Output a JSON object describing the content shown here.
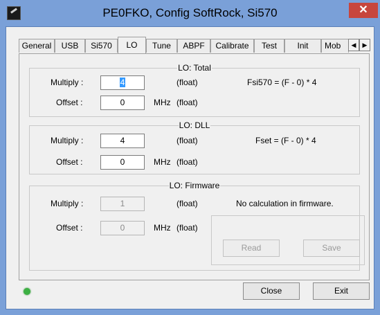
{
  "window": {
    "title": "PE0FKO, Config SoftRock, Si570",
    "close_glyph": "✕"
  },
  "tabs": [
    {
      "label": "General"
    },
    {
      "label": "USB"
    },
    {
      "label": "Si570"
    },
    {
      "label": "LO"
    },
    {
      "label": "Tune"
    },
    {
      "label": "ABPF"
    },
    {
      "label": "Calibrate"
    },
    {
      "label": "Test"
    },
    {
      "label": "Init"
    },
    {
      "label": "Mob"
    }
  ],
  "active_tab": "LO",
  "tab_scroll": {
    "left": "◀",
    "right": "▶"
  },
  "lo_total": {
    "title": "LO: Total",
    "multiply_label": "Multiply :",
    "multiply_value": "4",
    "multiply_unit": "(float)",
    "offset_label": "Offset :",
    "offset_value": "0",
    "offset_unit_mhz": "MHz",
    "offset_unit": "(float)",
    "formula": "Fsi570 = (F - 0) * 4"
  },
  "lo_dll": {
    "title": "LO: DLL",
    "multiply_label": "Multiply :",
    "multiply_value": "4",
    "multiply_unit": "(float)",
    "offset_label": "Offset :",
    "offset_value": "0",
    "offset_unit_mhz": "MHz",
    "offset_unit": "(float)",
    "formula": "Fset = (F - 0) * 4"
  },
  "lo_firmware": {
    "title": "LO: Firmware",
    "multiply_label": "Multiply :",
    "multiply_value": "1",
    "multiply_unit": "(float)",
    "offset_label": "Offset :",
    "offset_value": "0",
    "offset_unit_mhz": "MHz",
    "offset_unit": "(float)",
    "note": "No calculation in firmware.",
    "read_label": "Read",
    "save_label": "Save"
  },
  "footer": {
    "close_label": "Close",
    "exit_label": "Exit"
  },
  "colors": {
    "status_led": "#3cb043",
    "title_bar": "#7aa0d8",
    "close_button": "#c7463d"
  }
}
